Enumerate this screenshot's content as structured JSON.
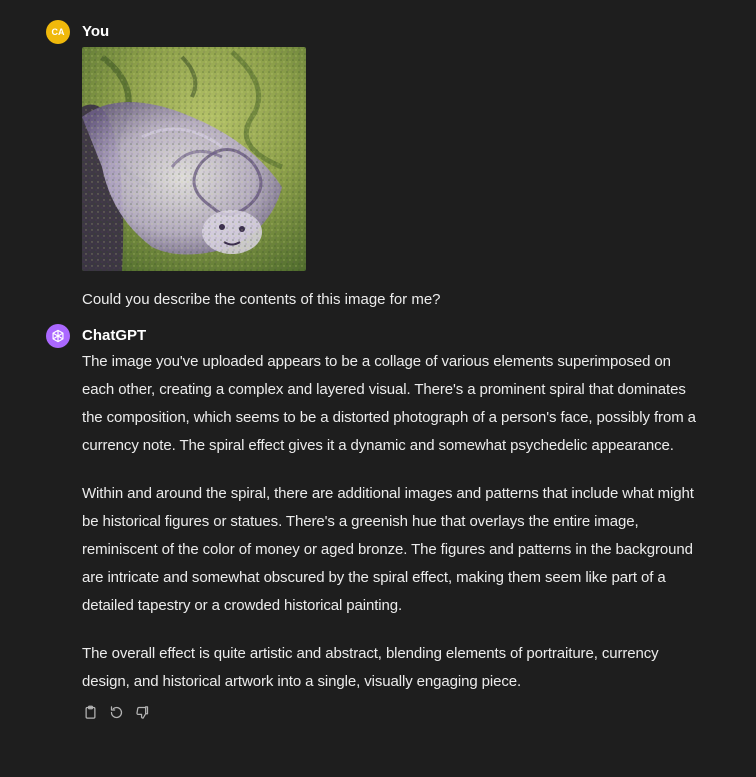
{
  "colors": {
    "background": "#1e1e1e",
    "text": "#ececec",
    "user_avatar": "#f0b90b",
    "gpt_avatar": "#ab68ff",
    "icon": "#b4b4b4"
  },
  "user_message": {
    "avatar_initials": "CA",
    "author": "You",
    "image_icon": "uploaded-image",
    "text": "Could you describe the contents of this image for me?"
  },
  "assistant_message": {
    "avatar_icon": "openai-logo-icon",
    "author": "ChatGPT",
    "paragraphs": [
      "The image you've uploaded appears to be a collage of various elements superimposed on each other, creating a complex and layered visual. There's a prominent spiral that dominates the composition, which seems to be a distorted photograph of a person's face, possibly from a currency note. The spiral effect gives it a dynamic and somewhat psychedelic appearance.",
      "Within and around the spiral, there are additional images and patterns that include what might be historical figures or statues. There's a greenish hue that overlays the entire image, reminiscent of the color of money or aged bronze. The figures and patterns in the background are intricate and somewhat obscured by the spiral effect, making them seem like part of a detailed tapestry or a crowded historical painting.",
      "The overall effect is quite artistic and abstract, blending elements of portraiture, currency design, and historical artwork into a single, visually engaging piece."
    ],
    "actions": [
      "copy-icon",
      "regenerate-icon",
      "thumbs-down-icon"
    ]
  }
}
